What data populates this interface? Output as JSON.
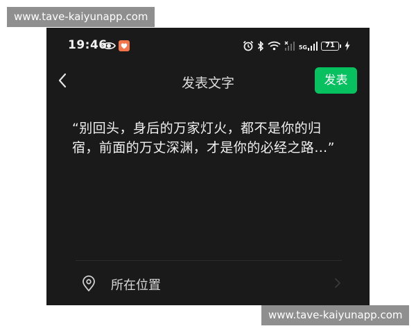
{
  "watermarks": {
    "top": "www.tave-kaiyunapp.com",
    "bottom": "www.tave-kaiyunapp.com"
  },
  "status_bar": {
    "time": "19:46",
    "left_icons": [
      "eye-icon",
      "app-notification-icon"
    ],
    "right_icons": [
      "alarm-icon",
      "bluetooth-icon",
      "wifi-icon",
      "signal-no-sim-icon",
      "signal-5g-icon",
      "battery-icon",
      "charging-icon"
    ],
    "network_label": "5G",
    "battery_level": "71"
  },
  "nav": {
    "title": "发表文字",
    "publish_label": "发表"
  },
  "post": {
    "text": "“别回头，身后的万家灯火，都不是你的归宿，前面的万丈深渊，才是你的必经之路…”"
  },
  "location": {
    "label": "所在位置",
    "icon": "location-pin-icon"
  },
  "colors": {
    "background": "#1a1a1a",
    "accent": "#07c160",
    "text": "#f0f0f0",
    "watermark_bg": "#8f8f8f"
  }
}
